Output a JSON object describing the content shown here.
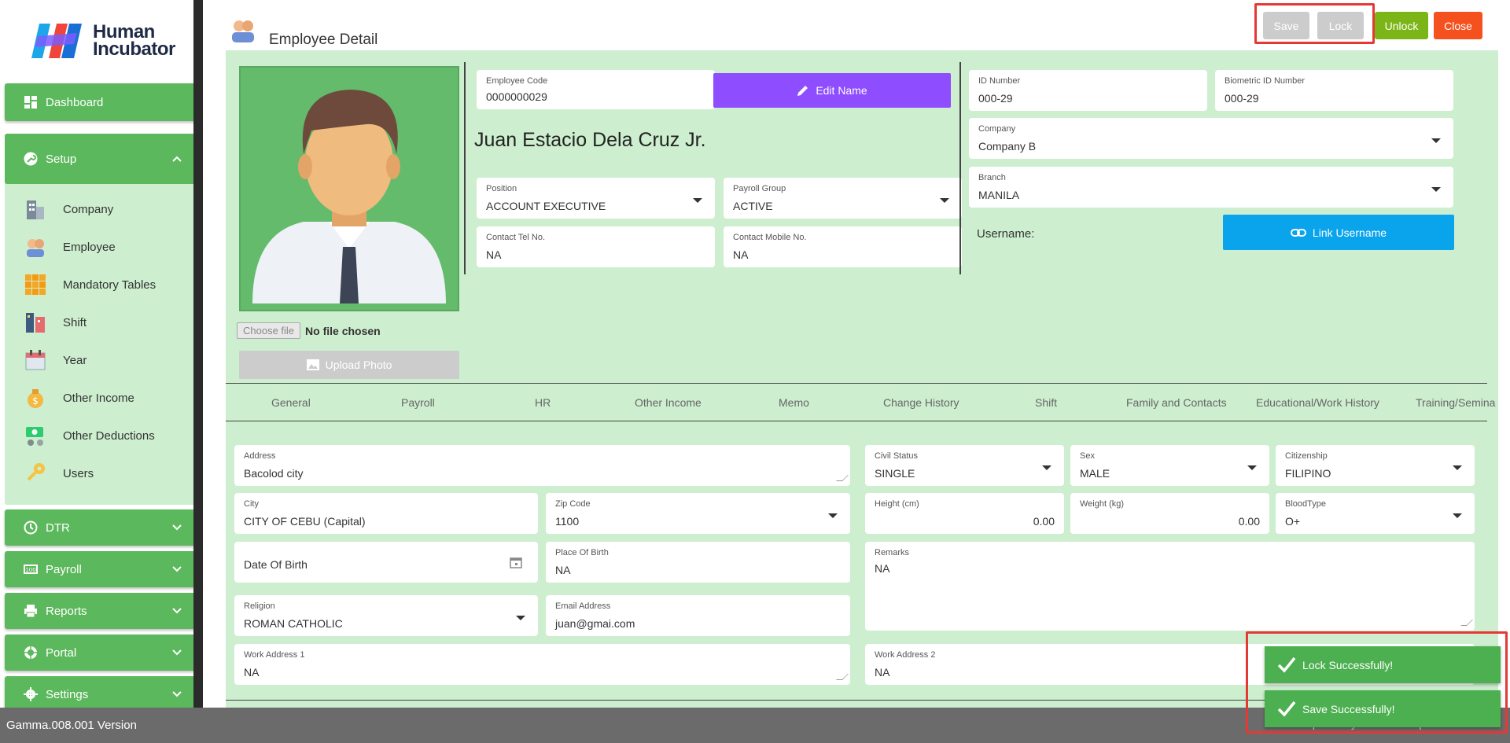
{
  "app": {
    "logo_line1": "Human",
    "logo_line2": "Incubator",
    "version": "Gamma.008.001 Version",
    "footer_url": "https://easyhr-demo.hi-api.io"
  },
  "sidebar": {
    "dashboard": "Dashboard",
    "setup": "Setup",
    "setup_items": [
      "Company",
      "Employee",
      "Mandatory Tables",
      "Shift",
      "Year",
      "Other Income",
      "Other Deductions",
      "Users"
    ],
    "dtr": "DTR",
    "payroll": "Payroll",
    "reports": "Reports",
    "portal": "Portal",
    "settings": "Settings"
  },
  "header": {
    "title": "Employee Detail",
    "save": "Save",
    "lock": "Lock",
    "unlock": "Unlock",
    "close": "Close"
  },
  "photo": {
    "choose_file": "Choose file",
    "no_file": "No file chosen",
    "upload": "Upload Photo"
  },
  "employee": {
    "code_label": "Employee Code",
    "code": "0000000029",
    "edit_name": "Edit Name",
    "full_name": "Juan Estacio  Dela Cruz Jr.",
    "position_label": "Position",
    "position": "ACCOUNT EXECUTIVE",
    "payroll_group_label": "Payroll Group",
    "payroll_group": "ACTIVE",
    "tel_label": "Contact Tel No.",
    "tel": "NA",
    "mobile_label": "Contact Mobile No.",
    "mobile": "NA",
    "id_label": "ID Number",
    "id": "000-29",
    "bio_label": "Biometric ID Number",
    "bio": "000-29",
    "company_label": "Company",
    "company": "Company B",
    "branch_label": "Branch",
    "branch": "MANILA",
    "username_label": "Username:",
    "link_username": "Link Username"
  },
  "tabs": [
    "General",
    "Payroll",
    "HR",
    "Other Income",
    "Memo",
    "Change History",
    "Shift",
    "Family and Contacts",
    "Educational/Work History",
    "Training/Semina"
  ],
  "general": {
    "address_label": "Address",
    "address": "Bacolod city",
    "civil_label": "Civil Status",
    "civil": "SINGLE",
    "sex_label": "Sex",
    "sex": "MALE",
    "citizenship_label": "Citizenship",
    "citizenship": "FILIPINO",
    "city_label": "City",
    "city": "CITY OF CEBU (Capital)",
    "zip_label": "Zip Code",
    "zip": "1100",
    "height_label": "Height (cm)",
    "height": "0.00",
    "weight_label": "Weight (kg)",
    "weight": "0.00",
    "blood_label": "BloodType",
    "blood": "O+",
    "dob_placeholder": "Date Of Birth",
    "pob_label": "Place Of Birth",
    "pob": "NA",
    "remarks_label": "Remarks",
    "remarks": "NA",
    "religion_label": "Religion",
    "religion": "ROMAN CATHOLIC",
    "email_label": "Email Address",
    "email": "juan@gmai.com",
    "work1_label": "Work Address 1",
    "work1": "NA",
    "work2_label": "Work Address 2",
    "work2": "NA"
  },
  "toasts": {
    "lock": "Lock Successfully!",
    "save": "Save Successfully!"
  },
  "colors": {
    "sidebar_green": "#5cb85c",
    "panel_green": "#cdeecf",
    "unlock": "#7cb518",
    "close": "#f4511e",
    "edit": "#8e4dff",
    "link": "#0aa4ec",
    "highlight": "#e53935"
  }
}
